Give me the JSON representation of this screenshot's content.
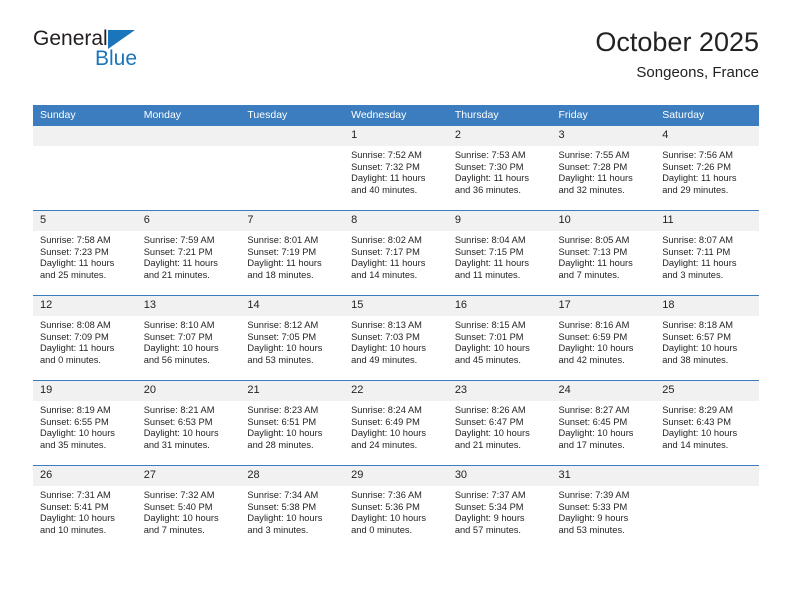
{
  "brand": {
    "name_part1": "General",
    "name_part2": "Blue",
    "logo_icon": "blue-triangle-icon"
  },
  "header": {
    "title": "October 2025",
    "subtitle": "Songeons, France"
  },
  "colors": {
    "header_blue": "#3b7dbf",
    "brand_blue": "#1b75bb",
    "daynum_band": "#f1f1f1",
    "text": "#231f20"
  },
  "weekday_headers": [
    "Sunday",
    "Monday",
    "Tuesday",
    "Wednesday",
    "Thursday",
    "Friday",
    "Saturday"
  ],
  "weeks": [
    [
      {
        "day": "",
        "sunrise": "",
        "sunset": "",
        "daylight_line1": "",
        "daylight_line2": "",
        "empty": true
      },
      {
        "day": "",
        "sunrise": "",
        "sunset": "",
        "daylight_line1": "",
        "daylight_line2": "",
        "empty": true
      },
      {
        "day": "",
        "sunrise": "",
        "sunset": "",
        "daylight_line1": "",
        "daylight_line2": "",
        "empty": true
      },
      {
        "day": "1",
        "sunrise": "Sunrise: 7:52 AM",
        "sunset": "Sunset: 7:32 PM",
        "daylight_line1": "Daylight: 11 hours",
        "daylight_line2": "and 40 minutes.",
        "empty": false
      },
      {
        "day": "2",
        "sunrise": "Sunrise: 7:53 AM",
        "sunset": "Sunset: 7:30 PM",
        "daylight_line1": "Daylight: 11 hours",
        "daylight_line2": "and 36 minutes.",
        "empty": false
      },
      {
        "day": "3",
        "sunrise": "Sunrise: 7:55 AM",
        "sunset": "Sunset: 7:28 PM",
        "daylight_line1": "Daylight: 11 hours",
        "daylight_line2": "and 32 minutes.",
        "empty": false
      },
      {
        "day": "4",
        "sunrise": "Sunrise: 7:56 AM",
        "sunset": "Sunset: 7:26 PM",
        "daylight_line1": "Daylight: 11 hours",
        "daylight_line2": "and 29 minutes.",
        "empty": false
      }
    ],
    [
      {
        "day": "5",
        "sunrise": "Sunrise: 7:58 AM",
        "sunset": "Sunset: 7:23 PM",
        "daylight_line1": "Daylight: 11 hours",
        "daylight_line2": "and 25 minutes.",
        "empty": false
      },
      {
        "day": "6",
        "sunrise": "Sunrise: 7:59 AM",
        "sunset": "Sunset: 7:21 PM",
        "daylight_line1": "Daylight: 11 hours",
        "daylight_line2": "and 21 minutes.",
        "empty": false
      },
      {
        "day": "7",
        "sunrise": "Sunrise: 8:01 AM",
        "sunset": "Sunset: 7:19 PM",
        "daylight_line1": "Daylight: 11 hours",
        "daylight_line2": "and 18 minutes.",
        "empty": false
      },
      {
        "day": "8",
        "sunrise": "Sunrise: 8:02 AM",
        "sunset": "Sunset: 7:17 PM",
        "daylight_line1": "Daylight: 11 hours",
        "daylight_line2": "and 14 minutes.",
        "empty": false
      },
      {
        "day": "9",
        "sunrise": "Sunrise: 8:04 AM",
        "sunset": "Sunset: 7:15 PM",
        "daylight_line1": "Daylight: 11 hours",
        "daylight_line2": "and 11 minutes.",
        "empty": false
      },
      {
        "day": "10",
        "sunrise": "Sunrise: 8:05 AM",
        "sunset": "Sunset: 7:13 PM",
        "daylight_line1": "Daylight: 11 hours",
        "daylight_line2": "and 7 minutes.",
        "empty": false
      },
      {
        "day": "11",
        "sunrise": "Sunrise: 8:07 AM",
        "sunset": "Sunset: 7:11 PM",
        "daylight_line1": "Daylight: 11 hours",
        "daylight_line2": "and 3 minutes.",
        "empty": false
      }
    ],
    [
      {
        "day": "12",
        "sunrise": "Sunrise: 8:08 AM",
        "sunset": "Sunset: 7:09 PM",
        "daylight_line1": "Daylight: 11 hours",
        "daylight_line2": "and 0 minutes.",
        "empty": false
      },
      {
        "day": "13",
        "sunrise": "Sunrise: 8:10 AM",
        "sunset": "Sunset: 7:07 PM",
        "daylight_line1": "Daylight: 10 hours",
        "daylight_line2": "and 56 minutes.",
        "empty": false
      },
      {
        "day": "14",
        "sunrise": "Sunrise: 8:12 AM",
        "sunset": "Sunset: 7:05 PM",
        "daylight_line1": "Daylight: 10 hours",
        "daylight_line2": "and 53 minutes.",
        "empty": false
      },
      {
        "day": "15",
        "sunrise": "Sunrise: 8:13 AM",
        "sunset": "Sunset: 7:03 PM",
        "daylight_line1": "Daylight: 10 hours",
        "daylight_line2": "and 49 minutes.",
        "empty": false
      },
      {
        "day": "16",
        "sunrise": "Sunrise: 8:15 AM",
        "sunset": "Sunset: 7:01 PM",
        "daylight_line1": "Daylight: 10 hours",
        "daylight_line2": "and 45 minutes.",
        "empty": false
      },
      {
        "day": "17",
        "sunrise": "Sunrise: 8:16 AM",
        "sunset": "Sunset: 6:59 PM",
        "daylight_line1": "Daylight: 10 hours",
        "daylight_line2": "and 42 minutes.",
        "empty": false
      },
      {
        "day": "18",
        "sunrise": "Sunrise: 8:18 AM",
        "sunset": "Sunset: 6:57 PM",
        "daylight_line1": "Daylight: 10 hours",
        "daylight_line2": "and 38 minutes.",
        "empty": false
      }
    ],
    [
      {
        "day": "19",
        "sunrise": "Sunrise: 8:19 AM",
        "sunset": "Sunset: 6:55 PM",
        "daylight_line1": "Daylight: 10 hours",
        "daylight_line2": "and 35 minutes.",
        "empty": false
      },
      {
        "day": "20",
        "sunrise": "Sunrise: 8:21 AM",
        "sunset": "Sunset: 6:53 PM",
        "daylight_line1": "Daylight: 10 hours",
        "daylight_line2": "and 31 minutes.",
        "empty": false
      },
      {
        "day": "21",
        "sunrise": "Sunrise: 8:23 AM",
        "sunset": "Sunset: 6:51 PM",
        "daylight_line1": "Daylight: 10 hours",
        "daylight_line2": "and 28 minutes.",
        "empty": false
      },
      {
        "day": "22",
        "sunrise": "Sunrise: 8:24 AM",
        "sunset": "Sunset: 6:49 PM",
        "daylight_line1": "Daylight: 10 hours",
        "daylight_line2": "and 24 minutes.",
        "empty": false
      },
      {
        "day": "23",
        "sunrise": "Sunrise: 8:26 AM",
        "sunset": "Sunset: 6:47 PM",
        "daylight_line1": "Daylight: 10 hours",
        "daylight_line2": "and 21 minutes.",
        "empty": false
      },
      {
        "day": "24",
        "sunrise": "Sunrise: 8:27 AM",
        "sunset": "Sunset: 6:45 PM",
        "daylight_line1": "Daylight: 10 hours",
        "daylight_line2": "and 17 minutes.",
        "empty": false
      },
      {
        "day": "25",
        "sunrise": "Sunrise: 8:29 AM",
        "sunset": "Sunset: 6:43 PM",
        "daylight_line1": "Daylight: 10 hours",
        "daylight_line2": "and 14 minutes.",
        "empty": false
      }
    ],
    [
      {
        "day": "26",
        "sunrise": "Sunrise: 7:31 AM",
        "sunset": "Sunset: 5:41 PM",
        "daylight_line1": "Daylight: 10 hours",
        "daylight_line2": "and 10 minutes.",
        "empty": false
      },
      {
        "day": "27",
        "sunrise": "Sunrise: 7:32 AM",
        "sunset": "Sunset: 5:40 PM",
        "daylight_line1": "Daylight: 10 hours",
        "daylight_line2": "and 7 minutes.",
        "empty": false
      },
      {
        "day": "28",
        "sunrise": "Sunrise: 7:34 AM",
        "sunset": "Sunset: 5:38 PM",
        "daylight_line1": "Daylight: 10 hours",
        "daylight_line2": "and 3 minutes.",
        "empty": false
      },
      {
        "day": "29",
        "sunrise": "Sunrise: 7:36 AM",
        "sunset": "Sunset: 5:36 PM",
        "daylight_line1": "Daylight: 10 hours",
        "daylight_line2": "and 0 minutes.",
        "empty": false
      },
      {
        "day": "30",
        "sunrise": "Sunrise: 7:37 AM",
        "sunset": "Sunset: 5:34 PM",
        "daylight_line1": "Daylight: 9 hours",
        "daylight_line2": "and 57 minutes.",
        "empty": false
      },
      {
        "day": "31",
        "sunrise": "Sunrise: 7:39 AM",
        "sunset": "Sunset: 5:33 PM",
        "daylight_line1": "Daylight: 9 hours",
        "daylight_line2": "and 53 minutes.",
        "empty": false
      },
      {
        "day": "",
        "sunrise": "",
        "sunset": "",
        "daylight_line1": "",
        "daylight_line2": "",
        "empty": true
      }
    ]
  ]
}
